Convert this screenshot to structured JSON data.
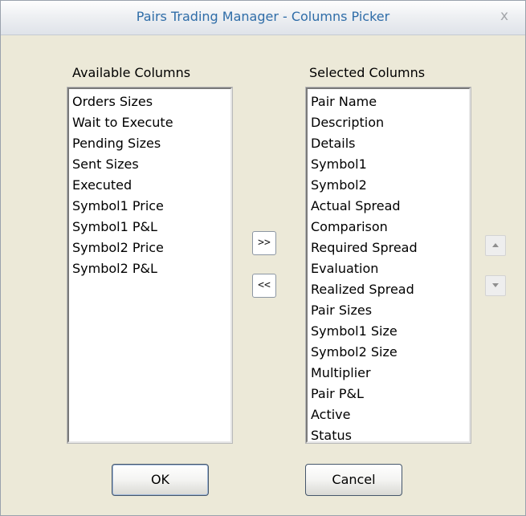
{
  "window": {
    "title": "Pairs Trading Manager - Columns Picker",
    "close_glyph": "x"
  },
  "available": {
    "label": "Available Columns",
    "items": [
      "Orders Sizes",
      "Wait to Execute",
      "Pending Sizes",
      "Sent Sizes",
      "Executed",
      "Symbol1 Price",
      "Symbol1 P&L",
      "Symbol2 Price",
      "Symbol2 P&L"
    ]
  },
  "selected": {
    "label": "Selected Columns",
    "items": [
      "Pair Name",
      "Description",
      "Details",
      "Symbol1",
      "Symbol2",
      "Actual Spread",
      "Comparison",
      "Required Spread",
      "Evaluation",
      "Realized Spread",
      "Pair Sizes",
      "Symbol1 Size",
      "Symbol2 Size",
      "Multiplier",
      "Pair P&L",
      "Active",
      "Status"
    ]
  },
  "transfer": {
    "add_label": ">>",
    "remove_label": "<<"
  },
  "order": {
    "up_icon": "triangle-up-icon",
    "down_icon": "triangle-down-icon"
  },
  "buttons": {
    "ok_label": "OK",
    "cancel_label": "Cancel"
  }
}
